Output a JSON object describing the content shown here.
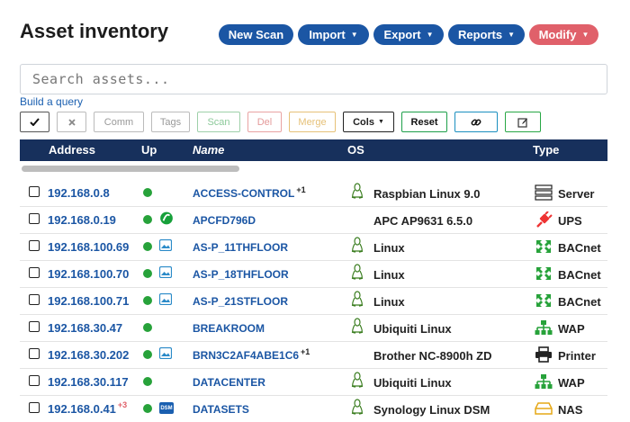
{
  "page": {
    "title": "Asset inventory"
  },
  "header_buttons": [
    {
      "label": "New Scan",
      "dropdown": false,
      "color": "#1b56a4"
    },
    {
      "label": "Import",
      "dropdown": true,
      "color": "#1b56a4"
    },
    {
      "label": "Export",
      "dropdown": true,
      "color": "#1b56a4"
    },
    {
      "label": "Reports",
      "dropdown": true,
      "color": "#1b56a4"
    },
    {
      "label": "Modify",
      "dropdown": true,
      "color": "#e0606a"
    }
  ],
  "search": {
    "placeholder": "Search assets...",
    "value": ""
  },
  "build_query_label": "Build a query",
  "toolbar": {
    "check_icon": "check-icon",
    "x_icon": "x-icon",
    "comm": "Comm",
    "tags": "Tags",
    "scan": "Scan",
    "del": "Del",
    "merge": "Merge",
    "cols": "Cols",
    "reset": "Reset",
    "link_icon": "link-icon",
    "edit_icon": "edit-icon"
  },
  "columns": {
    "address": "Address",
    "up": "Up",
    "name": "Name",
    "os": "OS",
    "type": "Type"
  },
  "rows": [
    {
      "address": "192.168.0.8",
      "address_badge": "",
      "up_icon": "",
      "name": "ACCESS-CONTROL",
      "name_badge": "+1",
      "os_icon": "linux-icon",
      "os": "Raspbian Linux 9.0",
      "type_icon": "server-icon",
      "type": "Server"
    },
    {
      "address": "192.168.0.19",
      "address_badge": "",
      "up_icon": "apc-icon",
      "name": "APCFD796D",
      "name_badge": "",
      "os_icon": "",
      "os": "APC AP9631 6.5.0",
      "type_icon": "plug-icon",
      "type": "UPS"
    },
    {
      "address": "192.168.100.69",
      "address_badge": "",
      "up_icon": "image-icon",
      "name": "AS-P_11THFLOOR",
      "name_badge": "",
      "os_icon": "linux-icon",
      "os": "Linux",
      "type_icon": "bacnet-icon",
      "type": "BACnet"
    },
    {
      "address": "192.168.100.70",
      "address_badge": "",
      "up_icon": "image-icon",
      "name": "AS-P_18THFLOOR",
      "name_badge": "",
      "os_icon": "linux-icon",
      "os": "Linux",
      "type_icon": "bacnet-icon",
      "type": "BACnet"
    },
    {
      "address": "192.168.100.71",
      "address_badge": "",
      "up_icon": "image-icon",
      "name": "AS-P_21STFLOOR",
      "name_badge": "",
      "os_icon": "linux-icon",
      "os": "Linux",
      "type_icon": "bacnet-icon",
      "type": "BACnet"
    },
    {
      "address": "192.168.30.47",
      "address_badge": "",
      "up_icon": "",
      "name": "BREAKROOM",
      "name_badge": "",
      "os_icon": "linux-icon",
      "os": "Ubiquiti Linux",
      "type_icon": "network-icon",
      "type": "WAP"
    },
    {
      "address": "192.168.30.202",
      "address_badge": "",
      "up_icon": "image-icon",
      "name": "BRN3C2AF4ABE1C6",
      "name_badge": "+1",
      "os_icon": "",
      "os": "Brother NC-8900h ZD",
      "type_icon": "printer-icon",
      "type": "Printer"
    },
    {
      "address": "192.168.30.117",
      "address_badge": "",
      "up_icon": "",
      "name": "DATACENTER",
      "name_badge": "",
      "os_icon": "linux-icon",
      "os": "Ubiquiti Linux",
      "type_icon": "network-icon",
      "type": "WAP"
    },
    {
      "address": "192.168.0.41",
      "address_badge": "+3",
      "up_icon": "dsm-icon",
      "up_icon_text": "DSM",
      "name": "DATASETS",
      "name_badge": "",
      "os_icon": "linux-icon",
      "os": "Synology Linux DSM",
      "type_icon": "nas-icon",
      "type": "NAS"
    }
  ],
  "colors": {
    "header_bg": "#17305c",
    "primary": "#1b56a4",
    "danger": "#e0606a",
    "status_up": "#27a23a",
    "link": "#1a5fb0"
  }
}
